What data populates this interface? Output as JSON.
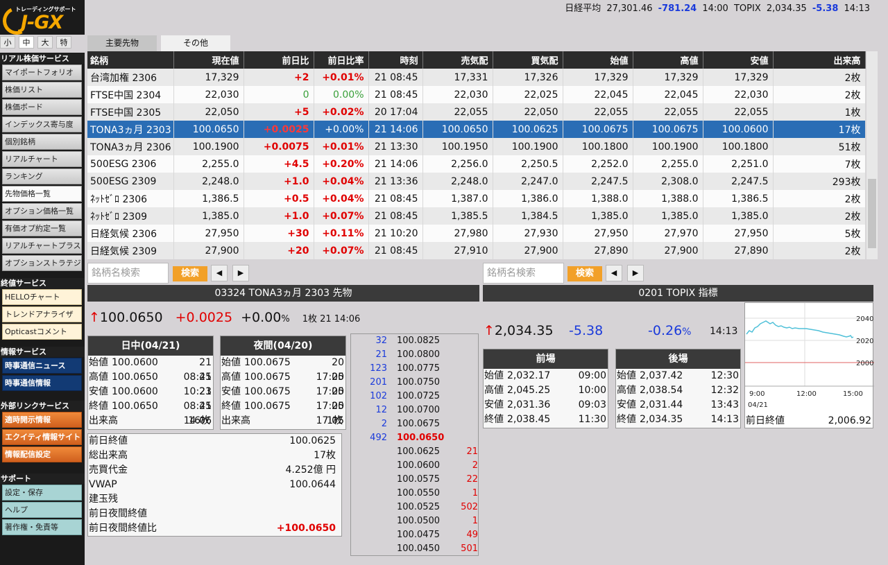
{
  "header": {
    "logo_sub": "トレーディングサポート",
    "logo_main": "J-GX",
    "nikkei_label": "日経平均",
    "nikkei_value": "27,301.46",
    "nikkei_change": "-781.24",
    "nikkei_time": "14:00",
    "topix_label": "TOPIX",
    "topix_value": "2,034.35",
    "topix_change": "-5.38",
    "topix_time": "14:13"
  },
  "size_buttons": [
    "小",
    "中",
    "大",
    "特"
  ],
  "sidebar": {
    "realtime_header": "リアル株価サービス",
    "realtime_items": [
      "マイポートフォリオ",
      "株価リスト",
      "株価ボード",
      "インデックス寄与度",
      "個別銘柄",
      "リアルチャート",
      "ランキング",
      "先物価格一覧",
      "オプション価格一覧",
      "有価オプ約定一覧",
      "リアルチャートプラス",
      "オプションストラテジ"
    ],
    "closing_header": "終値サービス",
    "closing_items": [
      "HELLOチャート",
      "トレンドアナライザ",
      "Opticastコメント"
    ],
    "info_header": "情報サービス",
    "info_items": [
      "時事通信ニュース",
      "時事通信情報"
    ],
    "external_header": "外部リンクサービス",
    "external_items": [
      "適時開示情報",
      "エクイティ情報サイト",
      "情報配信設定"
    ],
    "support_header": "サポート",
    "support_items": [
      "設定・保存",
      "ヘルプ",
      "著作権・免責等"
    ]
  },
  "tabs": [
    "主要先物",
    "その他"
  ],
  "table": {
    "columns": [
      "銘柄",
      "現在値",
      "前日比",
      "前日比率",
      "時刻",
      "売気配",
      "買気配",
      "始値",
      "高値",
      "安値",
      "出来高"
    ],
    "rows": [
      [
        "台湾加権 2306",
        "17,329",
        "+2",
        "+0.01%",
        "21 08:45",
        "17,331",
        "17,326",
        "17,329",
        "17,329",
        "17,329",
        "2枚"
      ],
      [
        "FTSE中国 2304",
        "22,030",
        "0",
        "0.00%",
        "21 08:45",
        "22,030",
        "22,025",
        "22,045",
        "22,045",
        "22,030",
        "2枚"
      ],
      [
        "FTSE中国 2305",
        "22,050",
        "+5",
        "+0.02%",
        "20 17:04",
        "22,055",
        "22,050",
        "22,055",
        "22,055",
        "22,055",
        "1枚"
      ],
      [
        "TONA3ヵ月 2303",
        "100.0650",
        "+0.0025",
        "+0.00%",
        "21 14:06",
        "100.0650",
        "100.0625",
        "100.0675",
        "100.0675",
        "100.0600",
        "17枚"
      ],
      [
        "TONA3ヵ月 2306",
        "100.1900",
        "+0.0075",
        "+0.01%",
        "21 13:30",
        "100.1950",
        "100.1900",
        "100.1800",
        "100.1900",
        "100.1800",
        "51枚"
      ],
      [
        "500ESG 2306",
        "2,255.0",
        "+4.5",
        "+0.20%",
        "21 14:06",
        "2,256.0",
        "2,250.5",
        "2,252.0",
        "2,255.0",
        "2,251.0",
        "7枚"
      ],
      [
        "500ESG 2309",
        "2,248.0",
        "+1.0",
        "+0.04%",
        "21 13:36",
        "2,248.0",
        "2,247.0",
        "2,247.5",
        "2,308.0",
        "2,247.5",
        "293枚"
      ],
      [
        "ﾈｯﾄｾﾞﾛ 2306",
        "1,386.5",
        "+0.5",
        "+0.04%",
        "21 08:45",
        "1,387.0",
        "1,386.0",
        "1,388.0",
        "1,388.0",
        "1,386.5",
        "2枚"
      ],
      [
        "ﾈｯﾄｾﾞﾛ 2309",
        "1,385.0",
        "+1.0",
        "+0.07%",
        "21 08:45",
        "1,385.5",
        "1,384.5",
        "1,385.0",
        "1,385.0",
        "1,385.0",
        "2枚"
      ],
      [
        "日経気候 2306",
        "27,950",
        "+30",
        "+0.11%",
        "21 10:20",
        "27,980",
        "27,930",
        "27,950",
        "27,970",
        "27,950",
        "5枚"
      ],
      [
        "日経気候 2309",
        "27,900",
        "+20",
        "+0.07%",
        "21 08:45",
        "27,910",
        "27,900",
        "27,890",
        "27,900",
        "27,890",
        "2枚"
      ]
    ]
  },
  "search": {
    "placeholder": "銘柄名検索",
    "button": "検索",
    "prev": "◀",
    "next": "▶"
  },
  "left_panel": {
    "title": "03324 TONA3ヵ月 2303 先物",
    "arrow": "↑",
    "price": "100.0650",
    "change": "+0.0025",
    "change_pct": "+0.00",
    "pct_sign": "%",
    "volume_time": "1枚 21 14:06",
    "day_session": {
      "title": "日中(04/21)",
      "rows": [
        [
          "始値",
          "100.0600",
          "21 08:45"
        ],
        [
          "高値",
          "100.0650",
          "21 10:23"
        ],
        [
          "安値",
          "100.0600",
          "21 08:45"
        ],
        [
          "終値",
          "100.0650",
          "21 14:06"
        ]
      ],
      "volume_label": "出来高",
      "volume": "16枚"
    },
    "night_session": {
      "title": "夜間(04/20)",
      "rows": [
        [
          "始値",
          "100.0675",
          "20 17:05"
        ],
        [
          "高値",
          "100.0675",
          "20 17:05"
        ],
        [
          "安値",
          "100.0675",
          "20 17:05"
        ],
        [
          "終値",
          "100.0675",
          "20 17:05"
        ]
      ],
      "volume_label": "出来高",
      "volume": "1枚"
    },
    "details": [
      [
        "前日終値",
        "100.0625"
      ],
      [
        "総出来高",
        "17枚"
      ],
      [
        "売買代金",
        "4.252億 円"
      ],
      [
        "VWAP",
        "100.0644"
      ],
      [
        "建玉残",
        ""
      ],
      [
        "前日夜間終値",
        ""
      ],
      [
        "前日夜間終値比",
        "+100.0650"
      ]
    ],
    "orderbook": [
      [
        "32",
        "100.0825",
        ""
      ],
      [
        "21",
        "100.0800",
        ""
      ],
      [
        "123",
        "100.0775",
        ""
      ],
      [
        "201",
        "100.0750",
        ""
      ],
      [
        "102",
        "100.0725",
        ""
      ],
      [
        "12",
        "100.0700",
        ""
      ],
      [
        "2",
        "100.0675",
        ""
      ],
      [
        "492",
        "100.0650",
        ""
      ],
      [
        "",
        "100.0625",
        "21"
      ],
      [
        "",
        "100.0600",
        "2"
      ],
      [
        "",
        "100.0575",
        "22"
      ],
      [
        "",
        "100.0550",
        "1"
      ],
      [
        "",
        "100.0525",
        "502"
      ],
      [
        "",
        "100.0500",
        "1"
      ],
      [
        "",
        "100.0475",
        "49"
      ],
      [
        "",
        "100.0450",
        "501"
      ]
    ]
  },
  "right_panel": {
    "title": "0201 TOPIX 指標",
    "arrow": "↑",
    "price": "2,034.35",
    "change": "-5.38",
    "change_pct": "-0.26",
    "pct_sign": "%",
    "time": "14:13",
    "morning": {
      "title": "前場",
      "rows": [
        [
          "始値",
          "2,032.17",
          "09:00"
        ],
        [
          "高値",
          "2,045.25",
          "10:00"
        ],
        [
          "安値",
          "2,031.36",
          "09:03"
        ],
        [
          "終値",
          "2,038.45",
          "11:30"
        ]
      ]
    },
    "afternoon": {
      "title": "後場",
      "rows": [
        [
          "始値",
          "2,037.42",
          "12:30"
        ],
        [
          "高値",
          "2,038.54",
          "12:32"
        ],
        [
          "安値",
          "2,031.44",
          "13:43"
        ],
        [
          "終値",
          "2,034.35",
          "14:13"
        ]
      ]
    },
    "chart": {
      "y_ticks": [
        "2040",
        "2020",
        "2000"
      ],
      "x_ticks": [
        "9:00",
        "12:00",
        "15:00"
      ],
      "date": "04/21",
      "prev_close_label": "前日終値",
      "prev_close": "2,006.92"
    }
  },
  "colors": {
    "positive": "#e00000",
    "negative": "#1a3adb",
    "selected_row": "#2a6db5",
    "accent_orange": "#f2a028"
  }
}
